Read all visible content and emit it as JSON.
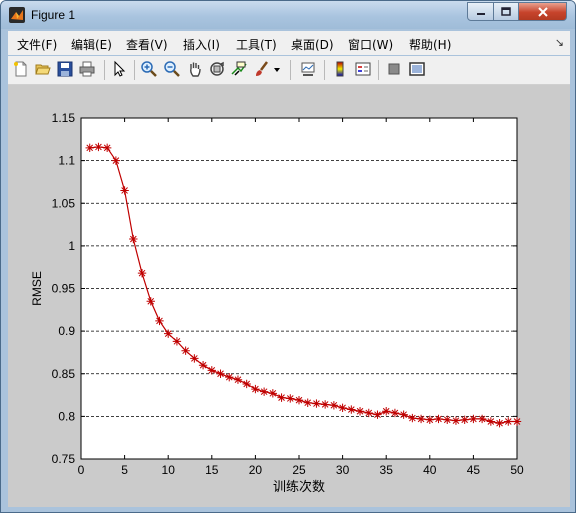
{
  "window": {
    "title": "Figure 1"
  },
  "menu": [
    "文件(F)",
    "编辑(E)",
    "查看(V)",
    "插入(I)",
    "工具(T)",
    "桌面(D)",
    "窗口(W)",
    "帮助(H)"
  ],
  "toolbar_icons": [
    "new-file-icon",
    "open-folder-icon",
    "save-icon",
    "print-icon",
    "pointer-icon",
    "zoom-in-icon",
    "zoom-out-icon",
    "pan-hand-icon",
    "rotate-3d-icon",
    "data-cursor-icon",
    "brush-icon",
    "brush-dropdown-icon",
    "link-plot-icon",
    "colorbar-icon",
    "legend-icon",
    "hide-plot-tools-icon",
    "show-plot-tools-icon"
  ],
  "chart_data": {
    "type": "line",
    "xlabel": "训练次数",
    "ylabel": "RMSE",
    "xlim": [
      0,
      50
    ],
    "ylim": [
      0.75,
      1.15
    ],
    "xticks": [
      "0",
      "5",
      "10",
      "15",
      "20",
      "25",
      "30",
      "35",
      "40",
      "45",
      "50"
    ],
    "yticks": [
      "0.75",
      "0.8",
      "0.85",
      "0.9",
      "0.95",
      "1",
      "1.05",
      "1.1",
      "1.15"
    ],
    "grid": "y-dashed",
    "marker": "*",
    "color": "#c00000",
    "x": [
      1,
      2,
      3,
      4,
      5,
      6,
      7,
      8,
      9,
      10,
      11,
      12,
      13,
      14,
      15,
      16,
      17,
      18,
      19,
      20,
      21,
      22,
      23,
      24,
      25,
      26,
      27,
      28,
      29,
      30,
      31,
      32,
      33,
      34,
      35,
      36,
      37,
      38,
      39,
      40,
      41,
      42,
      43,
      44,
      45,
      46,
      47,
      48,
      49,
      50
    ],
    "values": [
      1.115,
      1.116,
      1.115,
      1.1,
      1.065,
      1.008,
      0.968,
      0.935,
      0.912,
      0.897,
      0.888,
      0.877,
      0.868,
      0.86,
      0.854,
      0.85,
      0.846,
      0.843,
      0.838,
      0.832,
      0.829,
      0.827,
      0.822,
      0.821,
      0.819,
      0.816,
      0.815,
      0.814,
      0.813,
      0.81,
      0.808,
      0.806,
      0.804,
      0.802,
      0.806,
      0.804,
      0.802,
      0.798,
      0.797,
      0.796,
      0.797,
      0.796,
      0.795,
      0.796,
      0.797,
      0.797,
      0.794,
      0.792,
      0.794,
      0.794
    ]
  }
}
